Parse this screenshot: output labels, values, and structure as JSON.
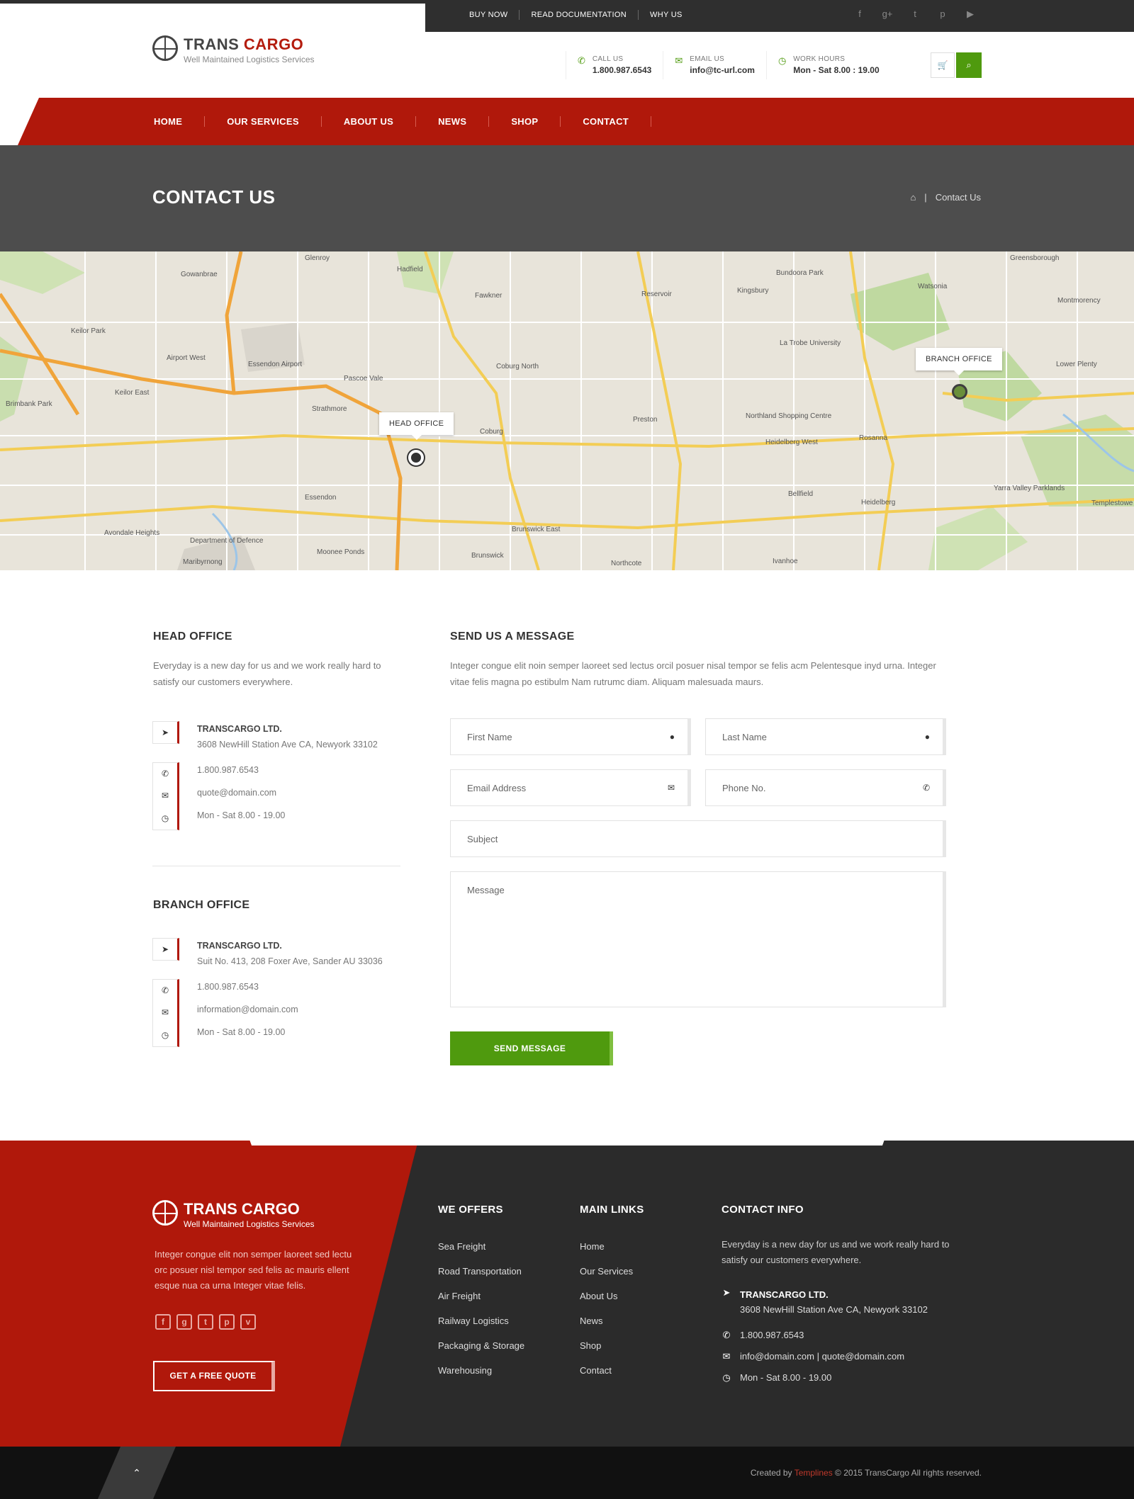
{
  "topbar": {
    "links": [
      "BUY NOW",
      "READ DOCUMENTATION",
      "WHY US"
    ],
    "social_icons": [
      "facebook-icon",
      "google-plus-icon",
      "twitter-icon",
      "pinterest-icon",
      "youtube-icon"
    ]
  },
  "brand": {
    "name_part1": "TRANS",
    "name_part2": "CARGO",
    "tagline": "Well Maintained Logistics Services"
  },
  "header_contacts": [
    {
      "label": "CALL US",
      "value": "1.800.987.6543",
      "icon": "phone-icon"
    },
    {
      "label": "EMAIL US",
      "value": "info@tc-url.com",
      "icon": "envelope-icon"
    },
    {
      "label": "WORK HOURS",
      "value": "Mon - Sat  8.00 : 19.00",
      "icon": "clock-icon"
    }
  ],
  "nav": [
    "HOME",
    "OUR SERVICES",
    "ABOUT US",
    "NEWS",
    "SHOP",
    "CONTACT"
  ],
  "banner": {
    "title": "CONTACT US",
    "breadcrumb_current": "Contact Us"
  },
  "map": {
    "markers": [
      "HEAD OFFICE",
      "BRANCH OFFICE"
    ],
    "places": [
      "Glenroy",
      "Hadfield",
      "Greensborough",
      "Gowanbrae",
      "Fawkner",
      "Reservoir",
      "Kingsbury",
      "Bundoora Park",
      "Watsonia",
      "Montmorency",
      "Keilor Park",
      "Airport West",
      "Essendon Airport",
      "Coburg North",
      "La Trobe University",
      "Lower Plenty",
      "Keilor East",
      "Pascoe Vale",
      "Strathmore",
      "Coburg",
      "Preston",
      "Northland Shopping Centre",
      "Heidelberg West",
      "Rosanna",
      "Brimbank Park",
      "Essendon",
      "Brunswick East",
      "Bellfield",
      "Heidelberg",
      "Yarra Valley Parklands",
      "Avondale Heights",
      "Moonee Ponds",
      "Brunswick",
      "Northcote",
      "Ivanhoe",
      "Templestowe",
      "Maribyrnong",
      "Department of Defence"
    ]
  },
  "head_office": {
    "title": "HEAD OFFICE",
    "desc": "Everyday is a new day for us and we work really hard to satisfy our customers everywhere.",
    "company": "TRANSCARGO LTD.",
    "address": "3608 NewHill Station Ave CA,  Newyork 33102",
    "phone": "1.800.987.6543",
    "email": "quote@domain.com",
    "hours": "Mon - Sat  8.00 - 19.00"
  },
  "branch_office": {
    "title": "BRANCH OFFICE",
    "company": "TRANSCARGO LTD.",
    "address": "Suit No. 413, 208 Foxer Ave, Sander AU 33036",
    "phone": "1.800.987.6543",
    "email": "information@domain.com",
    "hours": "Mon - Sat  8.00 - 19.00"
  },
  "form": {
    "title": "SEND US A MESSAGE",
    "desc": "Integer congue elit noin semper laoreet sed lectus orcil posuer nisal tempor se felis acm Pelentesque inyd urna. Integer vitae felis magna po estibulm Nam rutrumc diam. Aliquam malesuada maurs.",
    "first_name": "First Name",
    "last_name": "Last Name",
    "email": "Email Address",
    "phone": "Phone No.",
    "subject": "Subject",
    "message": "Message",
    "submit": "SEND MESSAGE"
  },
  "footer": {
    "desc": "Integer congue elit non semper laoreet sed lectu orc posuer nisl tempor sed felis ac mauris ellent esque nua ca urna Integer vitae felis.",
    "quote_button": "GET A FREE QUOTE",
    "offers_title": "WE OFFERS",
    "offers": [
      "Sea Freight",
      "Road Transportation",
      "Air Freight",
      "Railway Logistics",
      "Packaging & Storage",
      "Warehousing"
    ],
    "links_title": "MAIN LINKS",
    "links": [
      "Home",
      "Our Services",
      "About Us",
      "News",
      "Shop",
      "Contact"
    ],
    "contact_title": "CONTACT INFO",
    "contact_desc": "Everyday is a new day for us and we work really hard to satisfy our customers everywhere.",
    "company": "TRANSCARGO LTD.",
    "address": "3608 NewHill Station Ave CA, Newyork 33102",
    "phone": "1.800.987.6543",
    "emails": "info@domain.com  |  quote@domain.com",
    "hours": "Mon - Sat  8.00 - 19.00"
  },
  "copyright": {
    "prefix": "Created by ",
    "brand": "Templines",
    "suffix": " © 2015 TransCargo All rights reserved."
  },
  "colors": {
    "brand_red": "#b0180b",
    "accent_green": "#4f9a0e",
    "dark": "#2b2b2b"
  }
}
